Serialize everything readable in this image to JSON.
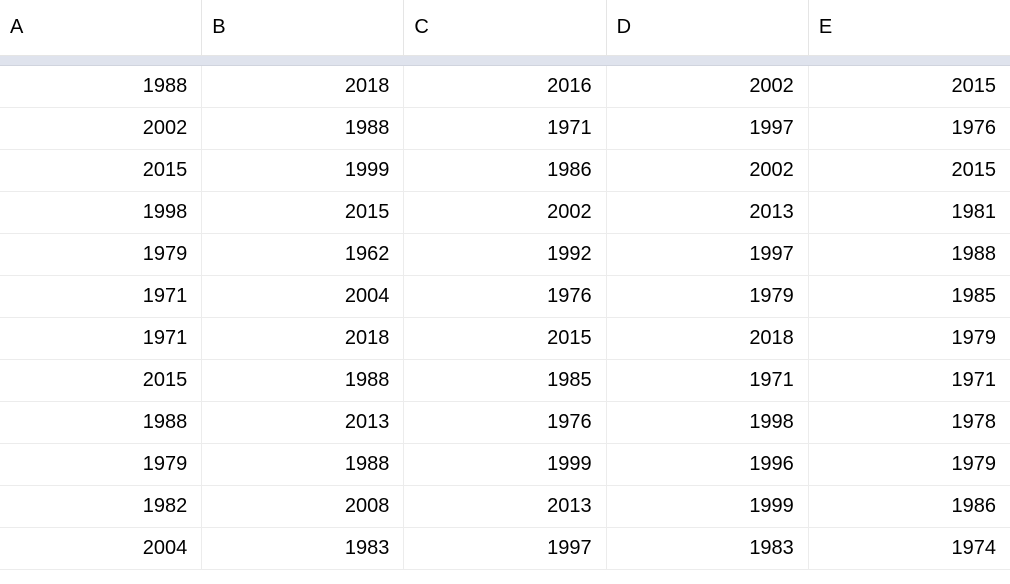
{
  "columns": [
    "A",
    "B",
    "C",
    "D",
    "E"
  ],
  "rows": [
    [
      1988,
      2018,
      2016,
      2002,
      2015
    ],
    [
      2002,
      1988,
      1971,
      1997,
      1976
    ],
    [
      2015,
      1999,
      1986,
      2002,
      2015
    ],
    [
      1998,
      2015,
      2002,
      2013,
      1981
    ],
    [
      1979,
      1962,
      1992,
      1997,
      1988
    ],
    [
      1971,
      2004,
      1976,
      1979,
      1985
    ],
    [
      1971,
      2018,
      2015,
      2018,
      1979
    ],
    [
      2015,
      1988,
      1985,
      1971,
      1971
    ],
    [
      1988,
      2013,
      1976,
      1998,
      1978
    ],
    [
      1979,
      1988,
      1999,
      1996,
      1979
    ],
    [
      1982,
      2008,
      2013,
      1999,
      1986
    ],
    [
      2004,
      1983,
      1997,
      1983,
      1974
    ]
  ]
}
